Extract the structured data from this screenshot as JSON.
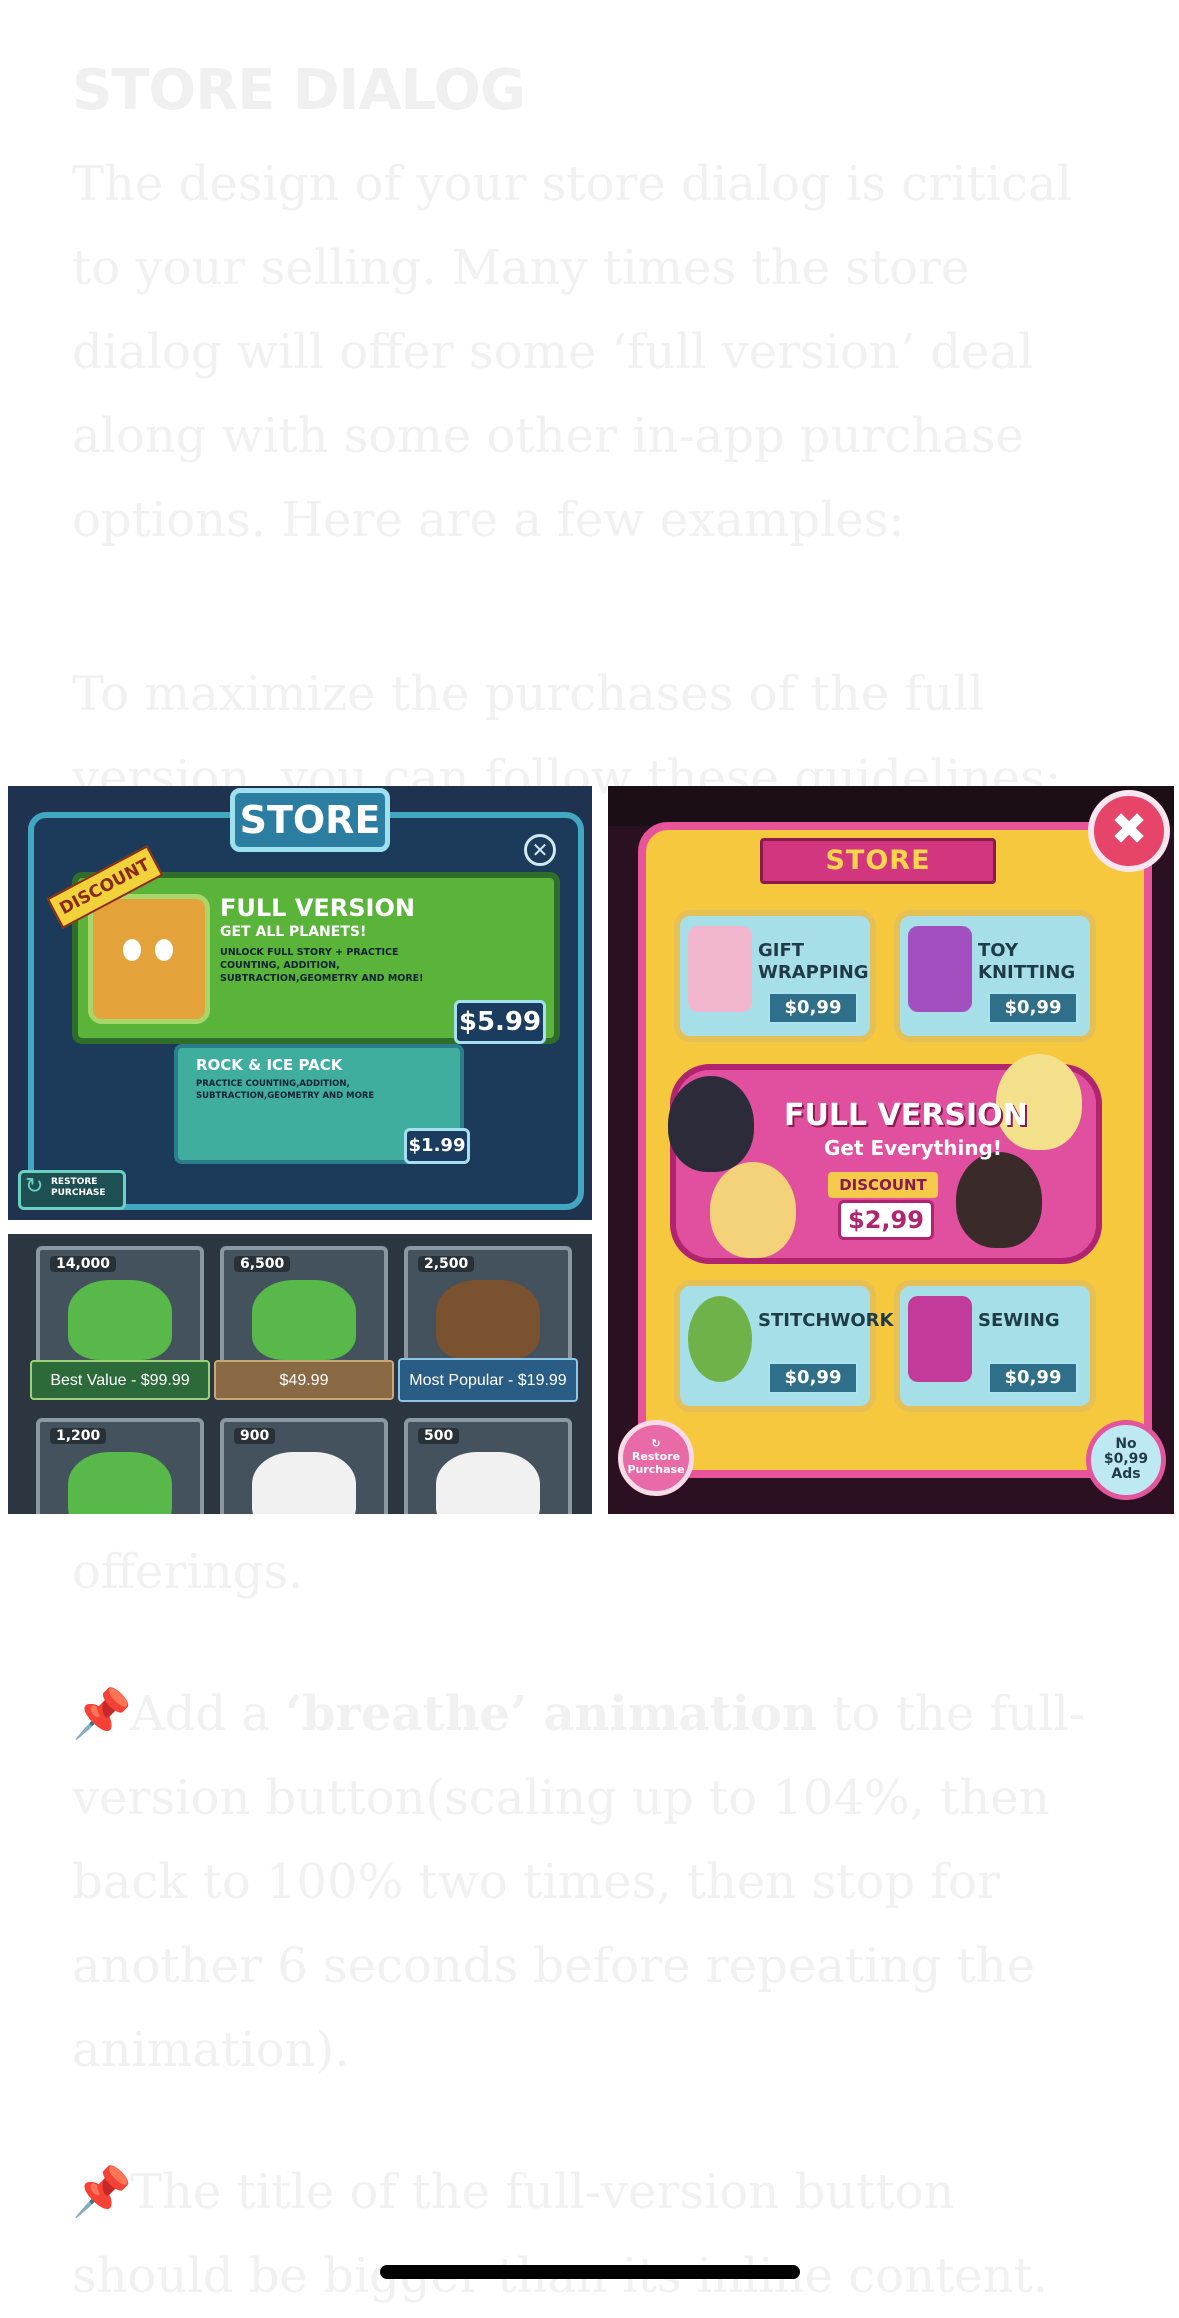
{
  "article": {
    "heading": "STORE DIALOG",
    "intro": "The design of your store dialog is critical to your selling. Many times the store dialog will offer some ‘full version’ deal along with some other in-app purchase options. Here are a few examples:",
    "guidelines_intro": "To maximize the purchases of the full version, you can follow these guidelines:",
    "offerings_tail": "offerings.",
    "tip1_pre": "Add a ",
    "tip1_bold": "‘breathe’ animation",
    "tip1_post": " to the full-version button(scaling up to 104%, then back to 100% two times, then stop for another 6 seconds before repeating the animation).",
    "tip2": "The title of the full-version button should be bigger than its inline content."
  },
  "store_a": {
    "title": "STORE",
    "discount_badge": "DISCOUNT",
    "full_title": "FULL VERSION",
    "full_subtitle": "GET ALL PLANETS!",
    "full_desc": "UNLOCK FULL STORY + PRACTICE COUNTING, ADDITION, SUBTRACTION,GEOMETRY AND MORE!",
    "full_price": "$5.99",
    "pack_title": "ROCK & ICE PACK",
    "pack_desc": "PRACTICE COUNTING,ADDITION, SUBTRACTION,GEOMETRY AND MORE",
    "pack_price": "$1.99",
    "restore_label": "RESTORE PURCHASE"
  },
  "store_b": {
    "items": [
      {
        "count": "14,000",
        "label": "Best Value - $99.99"
      },
      {
        "count": "6,500",
        "label": "$49.99"
      },
      {
        "count": "2,500",
        "label": "Most Popular - $19.99"
      },
      {
        "count": "1,200",
        "label": ""
      },
      {
        "count": "900",
        "label": ""
      },
      {
        "count": "500",
        "label": ""
      }
    ]
  },
  "store_c": {
    "title": "STORE",
    "items": [
      {
        "name": "GIFT WRAPPING",
        "price": "$0,99"
      },
      {
        "name": "TOY KNITTING",
        "price": "$0,99"
      },
      {
        "name": "STITCHWORK",
        "price": "$0,99"
      },
      {
        "name": "SEWING",
        "price": "$0,99"
      }
    ],
    "full_title": "FULL VERSION",
    "full_subtitle": "Get Everything!",
    "discount": "DISCOUNT",
    "full_price": "$2,99",
    "restore": "Restore Purchase",
    "noads_top": "No",
    "noads_price": "$0,99",
    "noads_bottom": "Ads"
  },
  "colors": {
    "faded_text": "#f1f1f1",
    "store_a_bg": "#1f3350",
    "store_c_accent": "#e8549a"
  },
  "icons": {
    "close_a": "✕",
    "close_c": "✖",
    "restore": "↻",
    "pin": "📌"
  }
}
